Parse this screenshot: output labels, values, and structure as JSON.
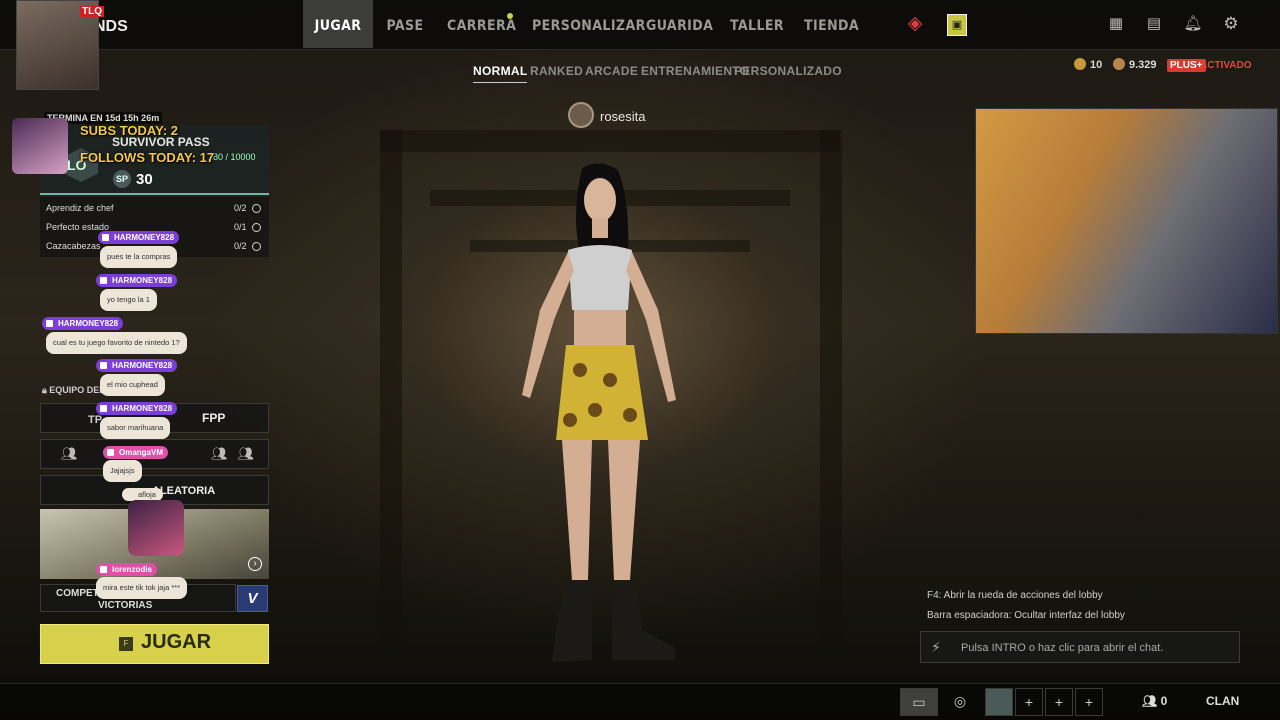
{
  "nav": {
    "logo": "NDS",
    "tabs": [
      "JUGAR",
      "PASE",
      "CARRERA",
      "PERSONALIZAR",
      "GUARIDA",
      "TALLER",
      "TIENDA"
    ]
  },
  "modes": [
    "NORMAL",
    "RANKED",
    "ARCADE",
    "ENTRENAMIENTO",
    "PERSONALIZADO"
  ],
  "currency": {
    "coin1": "10",
    "coin2": "9.329",
    "plus": "PLUS+",
    "plus_status": "ACTIVADO"
  },
  "player": {
    "name": "rosesita"
  },
  "stream_overlay": {
    "tag": "TLQ",
    "subs": "SUBS TODAY: 2",
    "follows": "FOLLOWS TODAY: 17"
  },
  "survivor_pass": {
    "ends": "TERMINA EN 15d 15h 26m",
    "title": "SURVIVOR PASS",
    "level": "LO",
    "progress": "180 / 10000",
    "sp_icon": "SP",
    "sp_value": "30"
  },
  "missions": [
    {
      "label": "Aprendiz de chef",
      "count": "0/2"
    },
    {
      "label": "Perfecto estado",
      "count": "0/1"
    },
    {
      "label": "Cazacabezas",
      "count": "0/2"
    }
  ],
  "chat": [
    {
      "user": "HARMONEY828",
      "msg": "pues te la compras"
    },
    {
      "user": "HARMONEY828",
      "msg": "yo tengo la 1"
    },
    {
      "user": "HARMONEY828",
      "msg": "cual es tu juego favorito de nintedo 1?"
    },
    {
      "user": "HARMONEY828",
      "msg": "el mio cuphead"
    },
    {
      "user": "HARMONEY828",
      "msg": "sabor marihuana"
    },
    {
      "user": "OmangaVM",
      "msg": "Jajajsjs"
    },
    {
      "user": "afloja",
      "msg": ""
    },
    {
      "user": "lorenzodis",
      "msg": "mira este tik tok jaja ***"
    }
  ],
  "team": {
    "label": "EQUIPO DEL",
    "mode_left": "TP",
    "mode_right": "FPP",
    "random": "ALEATORIA"
  },
  "competitive": {
    "label1": "COMPETICI",
    "label2": "VICTORIAS",
    "badge": "V"
  },
  "play": {
    "key": "F",
    "label": "JUGAR"
  },
  "hints": {
    "line1": "F4: Abrir la rueda de acciones del lobby",
    "line2": "Barra espaciadora: Ocultar interfaz del lobby"
  },
  "chat_input": {
    "placeholder": "Pulsa INTRO o haz clic para abrir el chat."
  },
  "bottom": {
    "friends_count": "0",
    "clan": "CLAN",
    "plus1": "+",
    "plus2": "+",
    "plus3": "+"
  }
}
